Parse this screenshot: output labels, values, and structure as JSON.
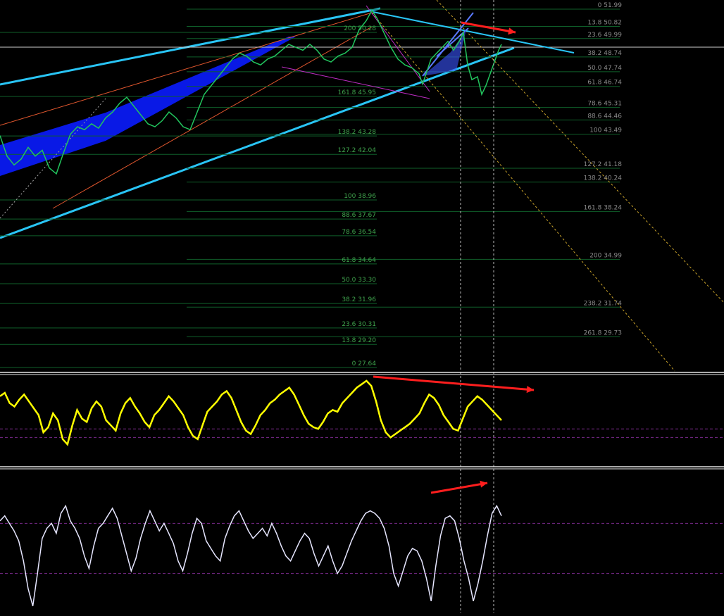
{
  "chart_data": [
    {
      "type": "line",
      "panel": "price",
      "grid": false,
      "y_unit": "price",
      "fib_levels_right": [
        {
          "ratio": "0",
          "price": 51.99
        },
        {
          "ratio": "13.8",
          "price": 50.82
        },
        {
          "ratio": "23.6",
          "price": 49.99
        },
        {
          "ratio": "38.2",
          "price": 48.74
        },
        {
          "ratio": "50.0",
          "price": 47.74
        },
        {
          "ratio": "61.8",
          "price": 46.74
        },
        {
          "ratio": "78.6",
          "price": 45.31
        },
        {
          "ratio": "88.6",
          "price": 44.46
        },
        {
          "ratio": "100",
          "price": 43.49
        },
        {
          "ratio": "127.2",
          "price": 41.18
        },
        {
          "ratio": "138.2",
          "price": 40.24
        },
        {
          "ratio": "161.8",
          "price": 38.24
        },
        {
          "ratio": "200",
          "price": 34.99
        },
        {
          "ratio": "238.2",
          "price": 31.74
        },
        {
          "ratio": "261.8",
          "price": 29.73
        }
      ],
      "fib_levels_left": [
        {
          "ratio": "200",
          "price": 50.28
        },
        {
          "ratio": "161.8",
          "price": 45.95
        },
        {
          "ratio": "138.2",
          "price": 43.28
        },
        {
          "ratio": "127.2",
          "price": 42.04
        },
        {
          "ratio": "100",
          "price": 38.96
        },
        {
          "ratio": "88.6",
          "price": 37.67
        },
        {
          "ratio": "78.6",
          "price": 36.54
        },
        {
          "ratio": "61.8",
          "price": 34.64
        },
        {
          "ratio": "50.0",
          "price": 33.3
        },
        {
          "ratio": "38.2",
          "price": 31.96
        },
        {
          "ratio": "23.6",
          "price": 30.31
        },
        {
          "ratio": "13.8",
          "price": 29.2
        },
        {
          "ratio": "0",
          "price": 27.64
        }
      ],
      "price_path": [
        [
          0,
          43.4
        ],
        [
          10,
          42.0
        ],
        [
          20,
          41.4
        ],
        [
          30,
          41.8
        ],
        [
          40,
          42.6
        ],
        [
          50,
          42.0
        ],
        [
          60,
          42.4
        ],
        [
          70,
          41.2
        ],
        [
          80,
          40.8
        ],
        [
          90,
          42.2
        ],
        [
          100,
          43.5
        ],
        [
          110,
          44.0
        ],
        [
          120,
          43.8
        ],
        [
          130,
          44.2
        ],
        [
          140,
          43.9
        ],
        [
          150,
          44.6
        ],
        [
          160,
          45.0
        ],
        [
          170,
          45.6
        ],
        [
          180,
          46.0
        ],
        [
          190,
          45.4
        ],
        [
          200,
          44.8
        ],
        [
          210,
          44.2
        ],
        [
          220,
          44.0
        ],
        [
          230,
          44.4
        ],
        [
          240,
          45.0
        ],
        [
          250,
          44.6
        ],
        [
          260,
          44.0
        ],
        [
          270,
          43.8
        ],
        [
          280,
          45.0
        ],
        [
          290,
          46.2
        ],
        [
          300,
          46.8
        ],
        [
          310,
          47.4
        ],
        [
          320,
          48.0
        ],
        [
          330,
          48.6
        ],
        [
          340,
          49.0
        ],
        [
          350,
          48.8
        ],
        [
          360,
          48.4
        ],
        [
          370,
          48.2
        ],
        [
          380,
          48.6
        ],
        [
          390,
          48.8
        ],
        [
          400,
          49.2
        ],
        [
          410,
          49.6
        ],
        [
          420,
          49.4
        ],
        [
          430,
          49.2
        ],
        [
          440,
          49.6
        ],
        [
          450,
          49.2
        ],
        [
          460,
          48.6
        ],
        [
          470,
          48.4
        ],
        [
          480,
          48.8
        ],
        [
          490,
          49.0
        ],
        [
          500,
          49.4
        ],
        [
          510,
          50.6
        ],
        [
          520,
          51.2
        ],
        [
          528,
          51.9
        ],
        [
          535,
          51.4
        ],
        [
          545,
          50.4
        ],
        [
          555,
          49.4
        ],
        [
          565,
          48.6
        ],
        [
          575,
          48.2
        ],
        [
          585,
          48.0
        ],
        [
          595,
          47.6
        ],
        [
          600,
          46.9
        ],
        [
          605,
          47.6
        ],
        [
          612,
          48.6
        ],
        [
          620,
          49.0
        ],
        [
          628,
          49.4
        ],
        [
          636,
          49.8
        ],
        [
          644,
          49.2
        ],
        [
          652,
          49.8
        ],
        [
          658,
          50.4
        ],
        [
          664,
          48.2
        ],
        [
          670,
          47.2
        ],
        [
          678,
          47.4
        ],
        [
          684,
          46.2
        ],
        [
          690,
          46.8
        ],
        [
          696,
          47.6
        ],
        [
          702,
          48.4
        ],
        [
          708,
          49.2
        ],
        [
          712,
          49.6
        ]
      ]
    },
    {
      "type": "line",
      "panel": "oscillator-1",
      "series": [
        {
          "values": [
            78,
            82,
            70,
            66,
            74,
            80,
            72,
            64,
            56,
            36,
            42,
            58,
            50,
            28,
            22,
            44,
            62,
            52,
            48,
            64,
            72,
            66,
            50,
            44,
            38,
            58,
            70,
            76,
            66,
            58,
            48,
            42,
            56,
            62,
            70,
            78,
            72,
            64,
            56,
            42,
            32,
            28,
            44,
            60,
            66,
            72,
            80,
            84,
            76,
            62,
            48,
            38,
            34,
            44,
            56,
            62,
            70,
            74,
            80,
            84,
            88,
            80,
            68,
            56,
            46,
            42,
            40,
            48,
            58,
            62,
            60,
            70,
            76,
            82,
            88,
            92,
            96,
            90,
            72,
            50,
            36,
            30,
            34,
            38,
            42,
            46,
            52,
            58,
            70,
            80,
            76,
            68,
            56,
            48,
            40,
            38,
            52,
            66,
            72,
            78,
            74,
            68,
            62,
            56,
            50
          ]
        }
      ],
      "ylim": [
        0,
        100
      ],
      "reference_levels": [
        40,
        30
      ]
    },
    {
      "type": "line",
      "panel": "oscillator-2",
      "series": [
        {
          "values": [
            72,
            76,
            70,
            64,
            56,
            40,
            18,
            4,
            30,
            58,
            66,
            70,
            62,
            78,
            84,
            72,
            66,
            58,
            44,
            34,
            52,
            66,
            70,
            76,
            82,
            74,
            60,
            46,
            32,
            42,
            58,
            70,
            80,
            72,
            64,
            70,
            62,
            54,
            40,
            32,
            46,
            62,
            74,
            70,
            56,
            50,
            44,
            40,
            58,
            68,
            76,
            80,
            72,
            64,
            58,
            62,
            66,
            60,
            70,
            62,
            52,
            44,
            40,
            48,
            56,
            62,
            58,
            46,
            36,
            44,
            52,
            40,
            30,
            36,
            46,
            56,
            64,
            72,
            78,
            80,
            78,
            74,
            66,
            52,
            30,
            20,
            32,
            44,
            50,
            48,
            40,
            26,
            8,
            36,
            60,
            74,
            76,
            72,
            58,
            40,
            26,
            8,
            22,
            40,
            60,
            78,
            84,
            76
          ]
        }
      ],
      "ylim": [
        0,
        100
      ],
      "reference_levels": [
        70,
        30
      ]
    }
  ],
  "colors": {
    "background": "#000000",
    "price_line": "#22c55e",
    "fib_line": "#0f5f2a",
    "fib_label_left": "#3fa34d",
    "fib_label_right": "#8a8a8a",
    "channel_cyan": "#29c5f6",
    "channel_fill": "#0a1cff",
    "trend_orange": "#e2572e",
    "magenta": "#c02cc6",
    "osc1_line": "#ffff00",
    "osc2_line": "#e6e6ff",
    "divergence_arrow": "#ff1e1e",
    "dotted_orange": "#c7a12a",
    "panel_separator": "#e6e6e6"
  }
}
